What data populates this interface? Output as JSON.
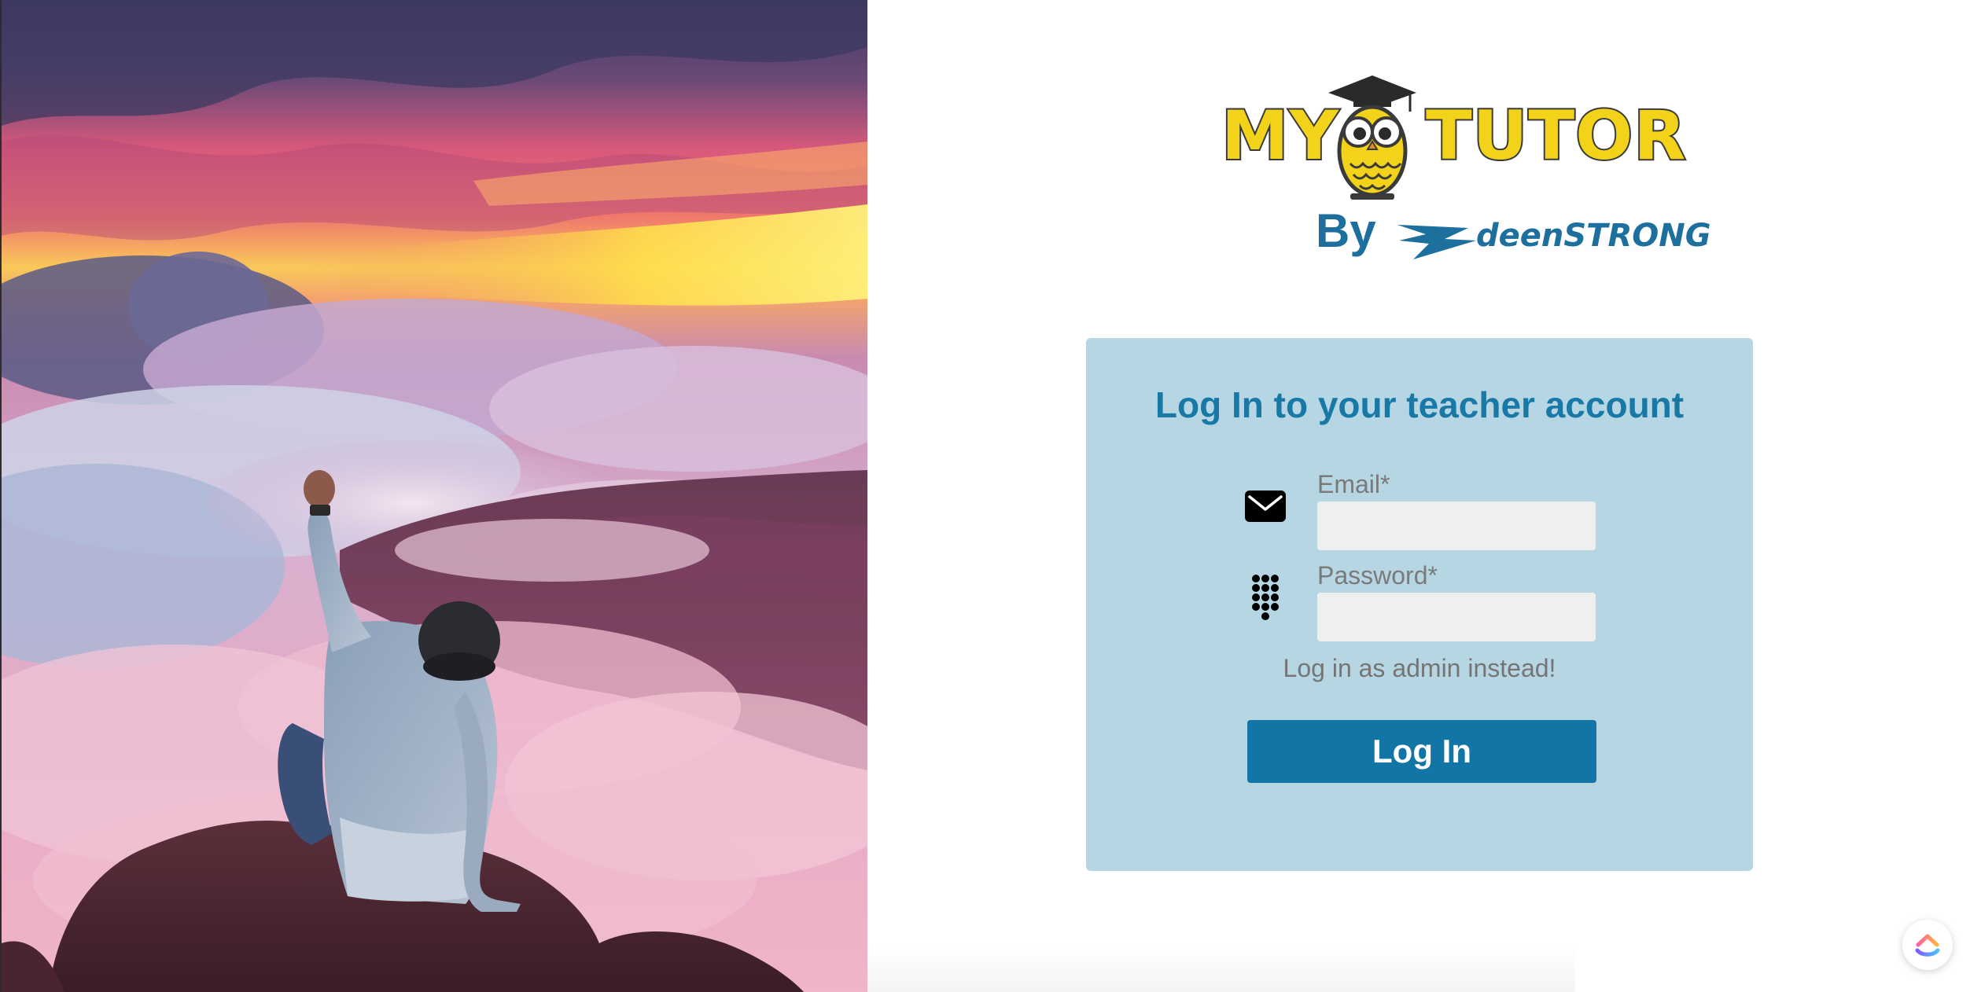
{
  "hero": {
    "icon": "photo-person-on-mountain-above-clouds"
  },
  "logo": {
    "word_left": "MY",
    "word_right": "TUTOR",
    "by": "By",
    "partner": "deenSTRONG",
    "colors": {
      "yellow": "#f3d31a",
      "outline": "#3a3a3a",
      "blue": "#1d6f9e"
    }
  },
  "login": {
    "title": "Log In to your teacher account",
    "email": {
      "label": "Email*",
      "value": "",
      "icon": "envelope-icon"
    },
    "password": {
      "label": "Password*",
      "value": "",
      "icon": "keypad-icon"
    },
    "admin_link": "Log in as admin instead!",
    "submit_label": "Log In",
    "colors": {
      "card_bg": "#b6d6e3",
      "title": "#1878a6",
      "button": "#1176a5"
    }
  },
  "widget": {
    "icon": "clickup-icon"
  }
}
